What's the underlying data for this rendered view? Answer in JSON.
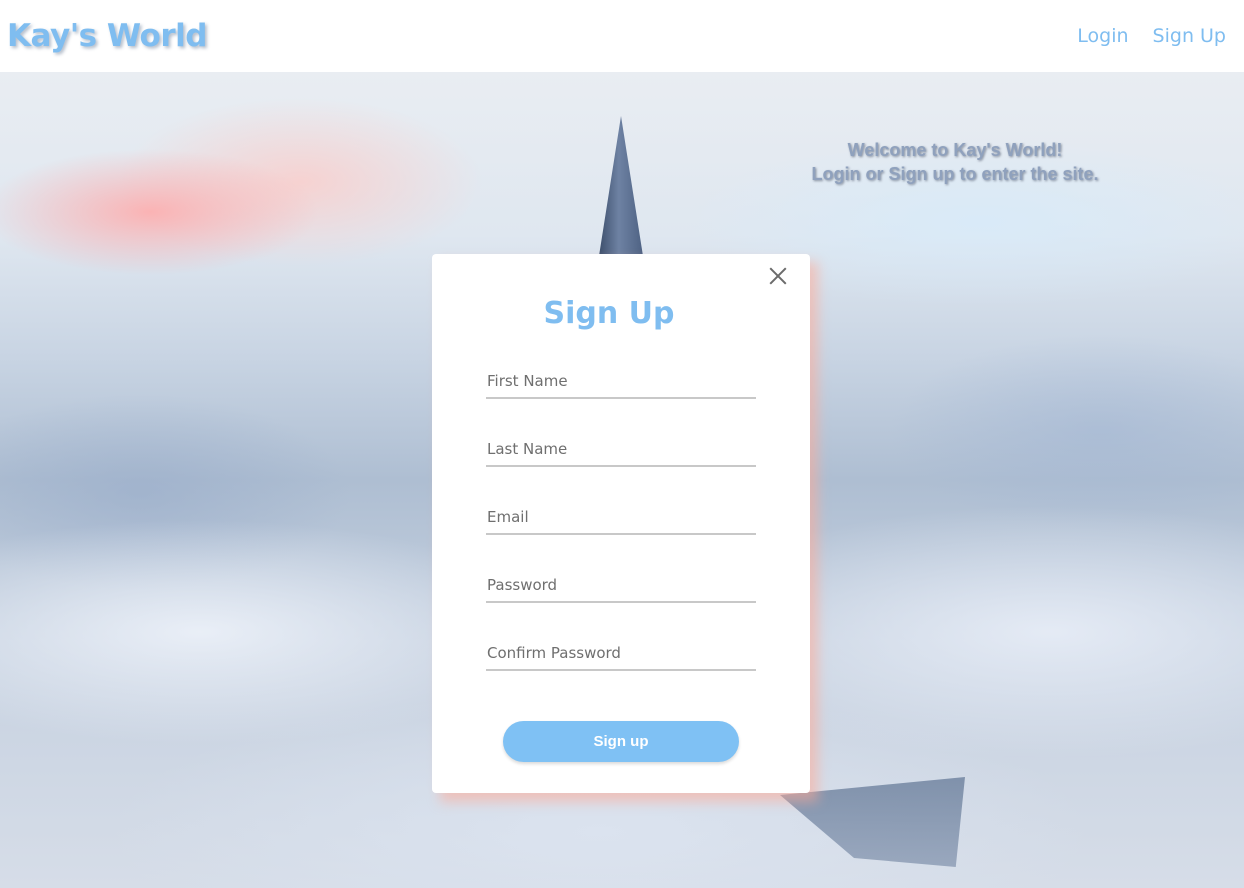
{
  "navbar": {
    "brand": "Kay's World",
    "links": [
      {
        "label": "Login"
      },
      {
        "label": "Sign Up"
      }
    ]
  },
  "hero": {
    "welcome_line1": "Welcome to Kay's World!",
    "welcome_line2": "Login or Sign up to enter the site."
  },
  "signup_modal": {
    "title": "Sign Up",
    "fields": {
      "first_name": {
        "placeholder": "First Name",
        "value": ""
      },
      "last_name": {
        "placeholder": "Last Name",
        "value": ""
      },
      "email": {
        "placeholder": "Email",
        "value": ""
      },
      "password": {
        "placeholder": "Password",
        "value": ""
      },
      "confirm_password": {
        "placeholder": "Confirm Password",
        "value": ""
      }
    },
    "submit_label": "Sign up",
    "close_icon": "close-icon"
  },
  "colors": {
    "accent": "#7fbdf0",
    "button": "#7fc1f4",
    "modal_glow": "#ffaa96"
  }
}
